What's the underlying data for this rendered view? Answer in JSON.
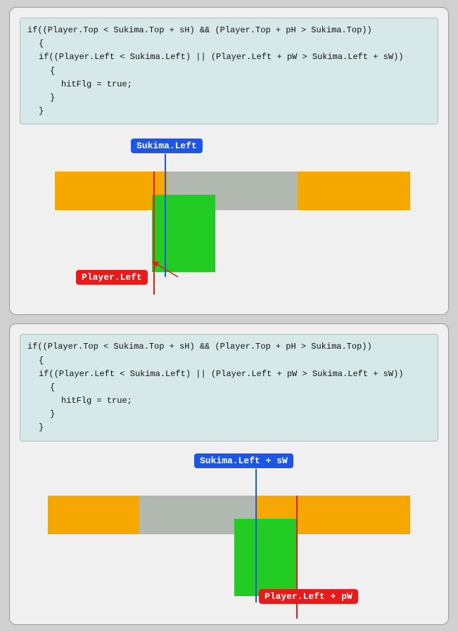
{
  "panel1": {
    "code": {
      "line1": "if((Player.Top < Sukima.Top + sH) && (Player.Top + pH > Sukima.Top))",
      "line2": "{",
      "line3": "if((Player.Left < Sukima.Left) || (Player.Left + pW > Sukima.Left + sW))",
      "line4": "{",
      "line5": "hitFlg = true;",
      "line6": "}",
      "line7": "}"
    },
    "labels": {
      "sukima_left": "Sukima.Left",
      "player_left": "Player.Left"
    }
  },
  "panel2": {
    "code": {
      "line1": "if((Player.Top < Sukima.Top + sH) && (Player.Top + pH > Sukima.Top))",
      "line2": "{",
      "line3": "if((Player.Left < Sukima.Left) || (Player.Left + pW > Sukima.Left + sW))",
      "line4": "{",
      "line5": "hitFlg = true;",
      "line6": "}",
      "line7": "}"
    },
    "labels": {
      "sukima_left_sw": "Sukima.Left + sW",
      "player_left_pw": "Player.Left + pW"
    }
  }
}
